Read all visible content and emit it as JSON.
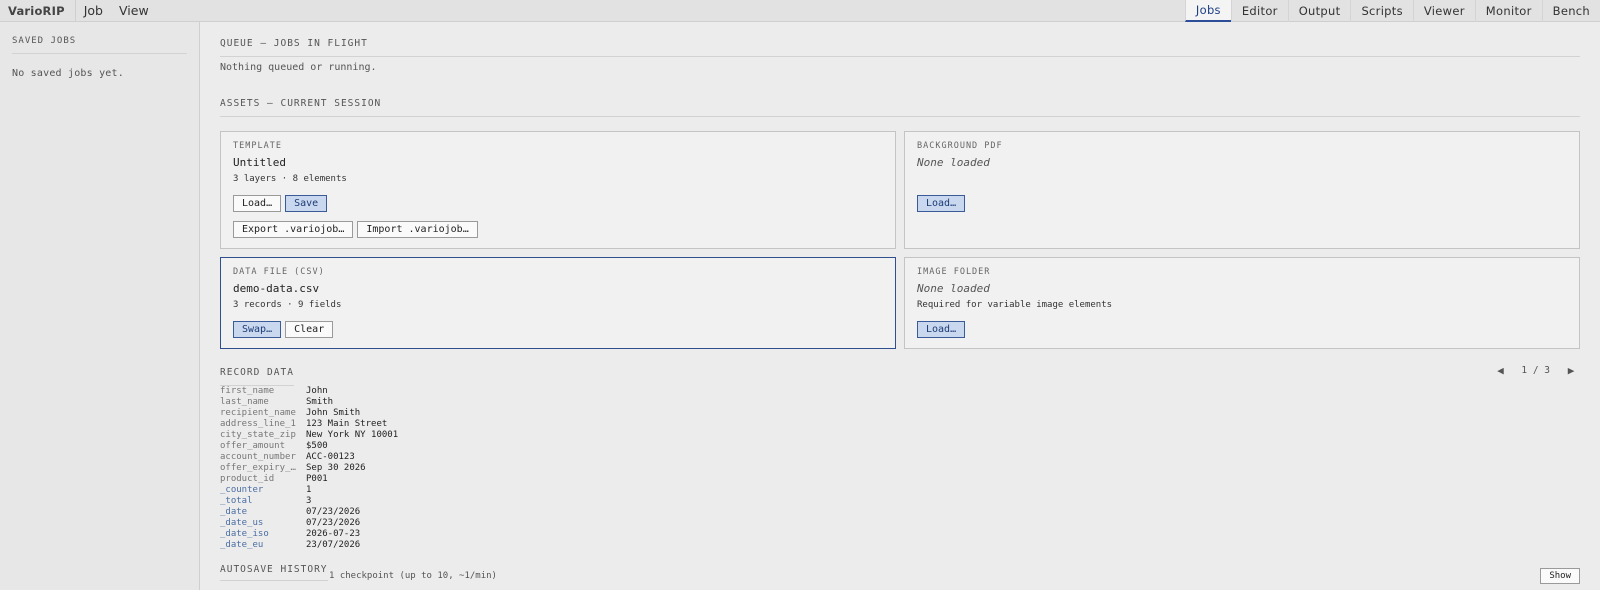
{
  "app": {
    "brand": "VarioRIP"
  },
  "menu": [
    "Job",
    "View"
  ],
  "tabs": [
    "Jobs",
    "Editor",
    "Output",
    "Scripts",
    "Viewer",
    "Monitor",
    "Bench"
  ],
  "active_tab": "Jobs",
  "sidebar": {
    "title": "SAVED JOBS",
    "empty": "No saved jobs yet."
  },
  "queue": {
    "title": "QUEUE — JOBS IN FLIGHT",
    "empty": "Nothing queued or running."
  },
  "assets": {
    "title": "ASSETS — CURRENT SESSION",
    "template": {
      "label": "TEMPLATE",
      "name": "Untitled",
      "meta": "3 layers · 8 elements",
      "load": "Load…",
      "save": "Save",
      "export": "Export .variojob…",
      "import": "Import .variojob…"
    },
    "background": {
      "label": "BACKGROUND PDF",
      "name": "None loaded",
      "load": "Load…"
    },
    "data_file": {
      "label": "DATA FILE (CSV)",
      "name": "demo-data.csv",
      "meta": "3 records · 9 fields",
      "swap": "Swap…",
      "clear": "Clear"
    },
    "image_folder": {
      "label": "IMAGE FOLDER",
      "name": "None loaded",
      "meta": "Required for variable image elements",
      "load": "Load…"
    }
  },
  "record": {
    "title": "RECORD DATA",
    "pager": {
      "prev": "◀",
      "count": "1 / 3",
      "next": "▶"
    },
    "fields": [
      {
        "key": "first_name",
        "value": "John",
        "system": false
      },
      {
        "key": "last_name",
        "value": "Smith",
        "system": false
      },
      {
        "key": "recipient_name",
        "value": "John Smith",
        "system": false
      },
      {
        "key": "address_line_1",
        "value": "123 Main Street",
        "system": false
      },
      {
        "key": "city_state_zip",
        "value": "New York NY 10001",
        "system": false
      },
      {
        "key": "offer_amount",
        "value": "$500",
        "system": false
      },
      {
        "key": "account_number",
        "value": "ACC-00123",
        "system": false
      },
      {
        "key": "offer_expiry_…",
        "value": "Sep 30 2026",
        "system": false
      },
      {
        "key": "product_id",
        "value": "P001",
        "system": false
      },
      {
        "key": "_counter",
        "value": "1",
        "system": true
      },
      {
        "key": "_total",
        "value": "3",
        "system": true
      },
      {
        "key": "_date",
        "value": "07/23/2026",
        "system": true
      },
      {
        "key": "_date_us",
        "value": "07/23/2026",
        "system": true
      },
      {
        "key": "_date_iso",
        "value": "2026-07-23",
        "system": true
      },
      {
        "key": "_date_eu",
        "value": "23/07/2026",
        "system": true
      }
    ]
  },
  "autosave": {
    "title": "AUTOSAVE HISTORY",
    "note": "1 checkpoint (up to 10, ~1/min)",
    "show": "Show"
  },
  "colors": {
    "accent": "#2c4d98",
    "primary_button": "#c9d8ef",
    "system_key": "#4b6ea3"
  }
}
